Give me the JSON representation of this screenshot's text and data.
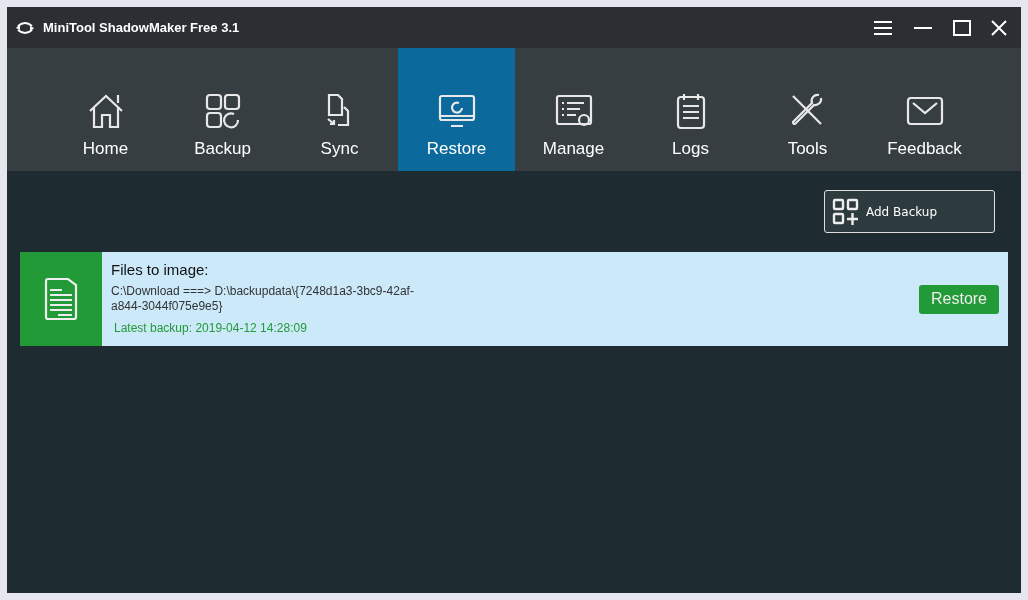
{
  "window": {
    "title": "MiniTool ShadowMaker Free 3.1"
  },
  "tabs": [
    {
      "label": "Home",
      "selected": false
    },
    {
      "label": "Backup",
      "selected": false
    },
    {
      "label": "Sync",
      "selected": false
    },
    {
      "label": "Restore",
      "selected": true
    },
    {
      "label": "Manage",
      "selected": false
    },
    {
      "label": "Logs",
      "selected": false
    },
    {
      "label": "Tools",
      "selected": false
    },
    {
      "label": "Feedback",
      "selected": false
    }
  ],
  "add_backup_button": "Add Backup",
  "backups": [
    {
      "title": "Files to image:",
      "path": " C:\\Download ===> D:\\backupdata\\{7248d1a3-3bc9-42af-a844-3044f075e9e5}",
      "latest": "Latest backup: 2019-04-12 14:28:09",
      "button": "Restore"
    }
  ]
}
